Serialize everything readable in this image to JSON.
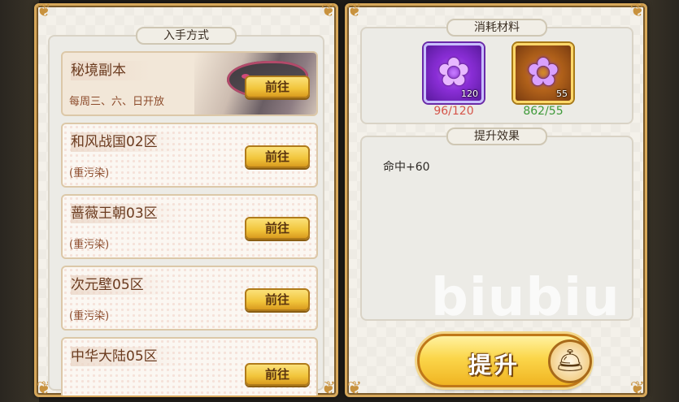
{
  "acquisition": {
    "title": "入手方式",
    "sources": [
      {
        "name": "秘境副本",
        "note": "每周三、六、日开放",
        "button": "前往",
        "featured": true
      },
      {
        "name": "和风战国02区",
        "note": "(重污染)",
        "button": "前往",
        "featured": false
      },
      {
        "name": "蔷薇王朝03区",
        "note": "(重污染)",
        "button": "前往",
        "featured": false
      },
      {
        "name": "次元壁05区",
        "note": "(重污染)",
        "button": "前往",
        "featured": false
      },
      {
        "name": "中华大陆05区",
        "note": "",
        "button": "前往",
        "featured": false
      }
    ]
  },
  "materials": {
    "title": "消耗材料",
    "items": [
      {
        "icon": "purple-flower-icon",
        "badge": "120",
        "count": "96/120",
        "status": "insufficient",
        "frame_color": "#8a2ed6"
      },
      {
        "icon": "purple-flower-icon",
        "badge": "55",
        "count": "862/55",
        "status": "sufficient",
        "frame_color": "#d9a02a"
      }
    ]
  },
  "effects": {
    "title": "提升效果",
    "lines": [
      "命中+60"
    ]
  },
  "upgrade": {
    "label": "提升",
    "icon": "bell-icon"
  },
  "watermark": "biubiu",
  "colors": {
    "insufficient": "#d5554a",
    "sufficient": "#3f9a3a",
    "button_gold": "#f1c43a",
    "panel_border": "#d7a85a"
  }
}
